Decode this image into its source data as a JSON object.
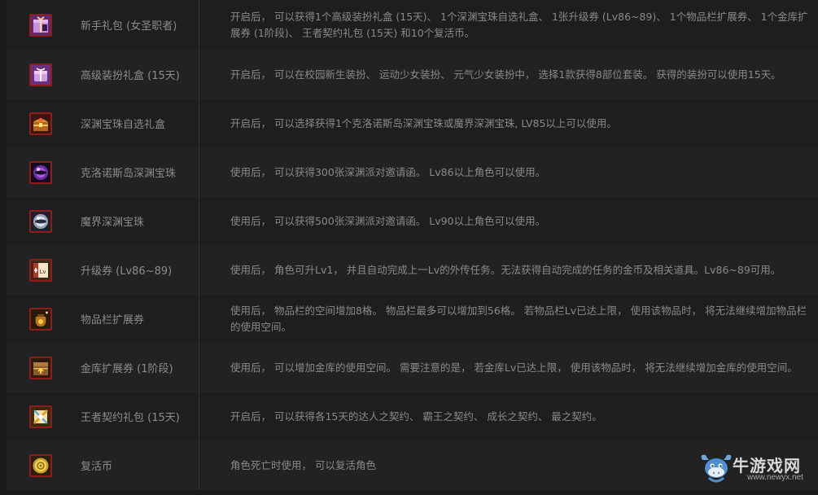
{
  "items": [
    {
      "icon": "female-mage-gift-icon",
      "name": "新手礼包 (女圣职者)",
      "desc": "开启后， 可以获得1个高级装扮礼盒 (15天)、 1个深渊宝珠自选礼盒、 1张升级券 (Lv86~89)、 1个物品栏扩展券、 1个金库扩展券 (1阶段)、 王者契约礼包 (15天) 和10个复活币。"
    },
    {
      "icon": "avatar-gift-box-icon",
      "name": "高级装扮礼盒 (15天)",
      "desc": "开启后， 可以在校园新生装扮、 运动少女装扮、 元气少女装扮中， 选择1款获得8部位套装。 获得的装扮可以使用15天。"
    },
    {
      "icon": "treasure-chest-icon",
      "name": "深渊宝珠自选礼盒",
      "desc": "开启后， 可以选择获得1个克洛诺斯岛深渊宝珠或魔界深渊宝珠, LV85以上可以使用。"
    },
    {
      "icon": "purple-abyss-orb-icon",
      "name": "克洛诺斯岛深渊宝珠",
      "desc": "使用后， 可以获得300张深渊派对邀请函。 Lv86以上角色可以使用。"
    },
    {
      "icon": "white-abyss-orb-icon",
      "name": "魔界深渊宝珠",
      "desc": "使用后， 可以获得500张深渊派对邀请函。 Lv90以上角色可以使用。"
    },
    {
      "icon": "level-up-ticket-icon",
      "name": "升级券 (Lv86~89)",
      "desc": "使用后， 角色可升Lv1， 并且自动完成上一Lv的外传任务。无法获得自动完成的任务的金币及相关道具。Lv86~89可用。"
    },
    {
      "icon": "inventory-bag-icon",
      "name": "物品栏扩展券",
      "desc": "使用后， 物品栏的空间增加8格。 物品栏最多可以增加到56格。 若物品栏Lv已达上限， 使用该物品时， 将无法继续增加物品栏的使用空间。"
    },
    {
      "icon": "storage-chest-icon",
      "name": "金库扩展券 (1阶段)",
      "desc": "使用后， 可以增加金库的使用空间。 需要注意的是， 若金库Lv已达上限， 使用该物品时， 将无法继续增加金库的使用空间。"
    },
    {
      "icon": "contract-pack-icon",
      "name": "王者契约礼包 (15天)",
      "desc": "开启后， 可以获得各15天的达人之契约、 霸王之契约、 成长之契约、 最之契约。"
    },
    {
      "icon": "revival-coin-icon",
      "name": "复活币",
      "desc": "角色死亡时使用， 可以复活角色"
    }
  ],
  "watermark": {
    "title": "牛游戏网",
    "url": "www.newyx.net"
  },
  "colors": {
    "icon_border": "#8f1d1d",
    "text": "#8a8a8a",
    "row_dark": "#1e1e1e",
    "row_light": "#222222"
  }
}
